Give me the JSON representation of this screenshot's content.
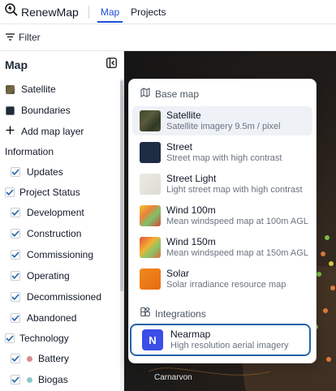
{
  "app": {
    "brand": "RenewMap"
  },
  "nav": {
    "tabs": [
      {
        "label": "Map"
      },
      {
        "label": "Projects"
      }
    ]
  },
  "filter": {
    "label": "Filter"
  },
  "sidebar": {
    "title": "Map",
    "layers": [
      {
        "label": "Satellite"
      },
      {
        "label": "Boundaries"
      }
    ],
    "add_layer": "Add map layer",
    "information_label": "Information",
    "updates_label": "Updates",
    "project_status_label": "Project Status",
    "statuses": [
      {
        "label": "Development"
      },
      {
        "label": "Construction"
      },
      {
        "label": "Commissioning"
      },
      {
        "label": "Operating"
      },
      {
        "label": "Decommissioned"
      },
      {
        "label": "Abandoned"
      }
    ],
    "technology_label": "Technology",
    "technologies": [
      {
        "label": "Battery",
        "color": "#d98b8b"
      },
      {
        "label": "Biogas",
        "color": "#8fc8cc"
      }
    ]
  },
  "map": {
    "place_label": "Carnarvon"
  },
  "basemap_menu": {
    "section_title": "Base map",
    "options": [
      {
        "title": "Satellite",
        "desc": "Satellite imagery 9.5m / pixel",
        "selected": true
      },
      {
        "title": "Street",
        "desc": "Street map with high contrast"
      },
      {
        "title": "Street Light",
        "desc": "Light street map with high contrast"
      },
      {
        "title": "Wind 100m",
        "desc": "Mean windspeed map at 100m AGL"
      },
      {
        "title": "Wind 150m",
        "desc": "Mean windspeed map at 150m AGL"
      },
      {
        "title": "Solar",
        "desc": "Solar irradiance resource map"
      }
    ],
    "integrations_title": "Integrations",
    "integration": {
      "logo_letter": "N",
      "title": "Nearmap",
      "desc": "High resolution aerial imagery"
    }
  }
}
